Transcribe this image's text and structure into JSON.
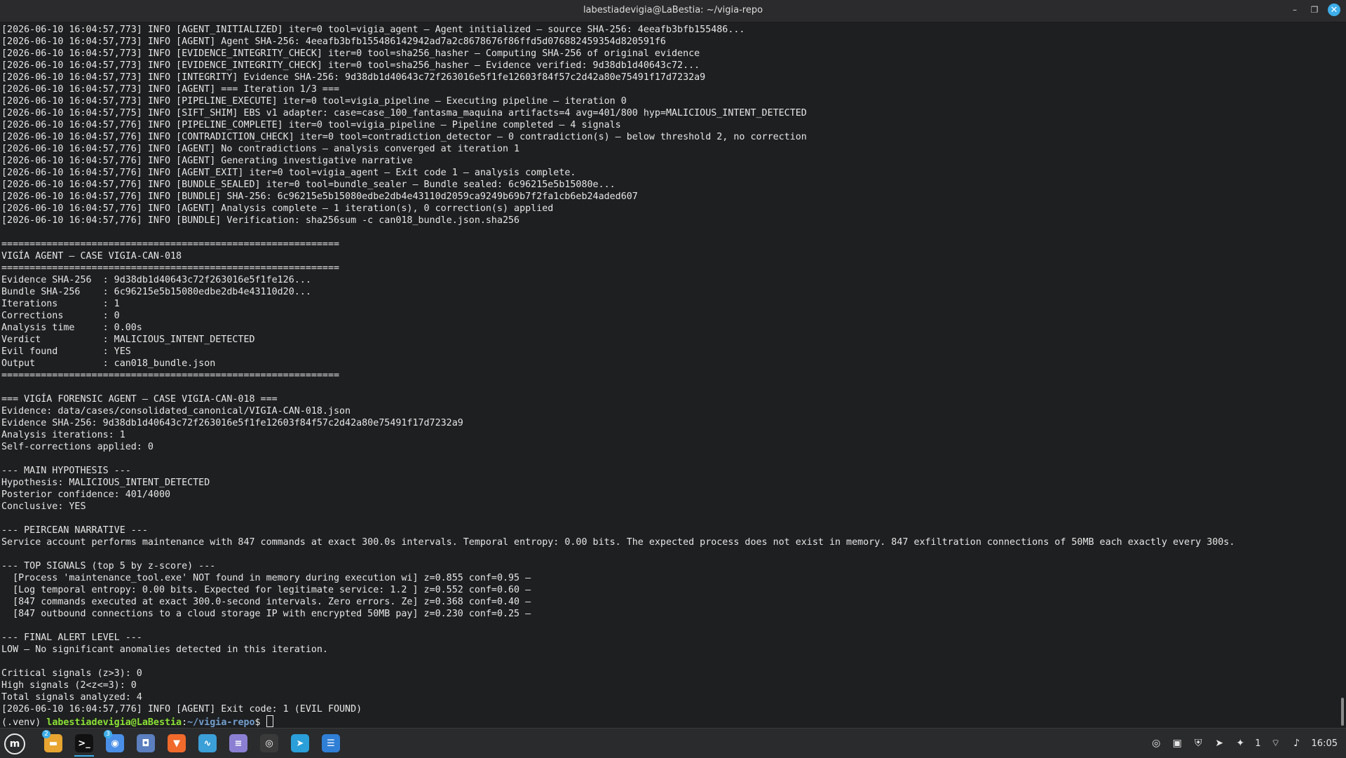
{
  "window": {
    "title": "labestiadevigia@LaBestia: ~/vigia-repo",
    "minimize_icon": "–",
    "restore_icon": "❐",
    "close_icon": "✕"
  },
  "terminal": {
    "lines": [
      "[2026-06-10 16:04:57,773] INFO [AGENT_INITIALIZED] iter=0 tool=vigia_agent — Agent initialized — source SHA-256: 4eeafb3bfb155486...",
      "[2026-06-10 16:04:57,773] INFO [AGENT] Agent SHA-256: 4eeafb3bfb155486142942ad7a2c8678676f86ffd5d076882459354d820591f6",
      "[2026-06-10 16:04:57,773] INFO [EVIDENCE_INTEGRITY_CHECK] iter=0 tool=sha256_hasher — Computing SHA-256 of original evidence",
      "[2026-06-10 16:04:57,773] INFO [EVIDENCE_INTEGRITY_CHECK] iter=0 tool=sha256_hasher — Evidence verified: 9d38db1d40643c72...",
      "[2026-06-10 16:04:57,773] INFO [INTEGRITY] Evidence SHA-256: 9d38db1d40643c72f263016e5f1fe12603f84f57c2d42a80e75491f17d7232a9",
      "[2026-06-10 16:04:57,773] INFO [AGENT] === Iteration 1/3 ===",
      "[2026-06-10 16:04:57,773] INFO [PIPELINE_EXECUTE] iter=0 tool=vigia_pipeline — Executing pipeline — iteration 0",
      "[2026-06-10 16:04:57,775] INFO [SIFT_SHIM] EBS v1 adapter: case=case_100_fantasma_maquina artifacts=4 avg=401/800 hyp=MALICIOUS_INTENT_DETECTED",
      "[2026-06-10 16:04:57,776] INFO [PIPELINE_COMPLETE] iter=0 tool=vigia_pipeline — Pipeline completed — 4 signals",
      "[2026-06-10 16:04:57,776] INFO [CONTRADICTION_CHECK] iter=0 tool=contradiction_detector — 0 contradiction(s) — below threshold 2, no correction",
      "[2026-06-10 16:04:57,776] INFO [AGENT] No contradictions — analysis converged at iteration 1",
      "[2026-06-10 16:04:57,776] INFO [AGENT] Generating investigative narrative",
      "[2026-06-10 16:04:57,776] INFO [AGENT_EXIT] iter=0 tool=vigia_agent — Exit code 1 — analysis complete.",
      "[2026-06-10 16:04:57,776] INFO [BUNDLE_SEALED] iter=0 tool=bundle_sealer — Bundle sealed: 6c96215e5b15080e...",
      "[2026-06-10 16:04:57,776] INFO [BUNDLE] SHA-256: 6c96215e5b15080edbe2db4e43110d2059ca9249b69b7f2fa1cb6eb24aded607",
      "[2026-06-10 16:04:57,776] INFO [AGENT] Analysis complete — 1 iteration(s), 0 correction(s) applied",
      "[2026-06-10 16:04:57,776] INFO [BUNDLE] Verification: sha256sum -c can018_bundle.json.sha256",
      "",
      "============================================================",
      "VIGÍA AGENT — CASE VIGIA-CAN-018",
      "============================================================",
      "Evidence SHA-256  : 9d38db1d40643c72f263016e5f1fe126...",
      "Bundle SHA-256    : 6c96215e5b15080edbe2db4e43110d20...",
      "Iterations        : 1",
      "Corrections       : 0",
      "Analysis time     : 0.00s",
      "Verdict           : MALICIOUS_INTENT_DETECTED",
      "Evil found        : YES",
      "Output            : can018_bundle.json",
      "============================================================",
      "",
      "=== VIGÍA FORENSIC AGENT — CASE VIGIA-CAN-018 ===",
      "Evidence: data/cases/consolidated_canonical/VIGIA-CAN-018.json",
      "Evidence SHA-256: 9d38db1d40643c72f263016e5f1fe12603f84f57c2d42a80e75491f17d7232a9",
      "Analysis iterations: 1",
      "Self-corrections applied: 0",
      "",
      "--- MAIN HYPOTHESIS ---",
      "Hypothesis: MALICIOUS_INTENT_DETECTED",
      "Posterior confidence: 401/4000",
      "Conclusive: YES",
      "",
      "--- PEIRCEAN NARRATIVE ---",
      "Service account performs maintenance with 847 commands at exact 300.0s intervals. Temporal entropy: 0.00 bits. The expected process does not exist in memory. 847 exfiltration connections of 50MB each exactly every 300s.",
      "",
      "--- TOP SIGNALS (top 5 by z-score) ---",
      "  [Process 'maintenance_tool.exe' NOT found in memory during execution wi] z=0.855 conf=0.95 —",
      "  [Log temporal entropy: 0.00 bits. Expected for legitimate service: 1.2 ] z=0.552 conf=0.60 —",
      "  [847 commands executed at exact 300.0-second intervals. Zero errors. Ze] z=0.368 conf=0.40 —",
      "  [847 outbound connections to a cloud storage IP with encrypted 50MB pay] z=0.230 conf=0.25 —",
      "",
      "--- FINAL ALERT LEVEL ---",
      "LOW — No significant anomalies detected in this iteration.",
      "",
      "Critical signals (z>3): 0",
      "High signals (2<z<=3): 0",
      "Total signals analyzed: 4",
      "[2026-06-10 16:04:57,776] INFO [AGENT] Exit code: 1 (EVIL FOUND)"
    ],
    "prompt": {
      "venv": "(.venv) ",
      "user_host": "labestiadevigia@LaBestia",
      "sep": ":",
      "path": "~/vigia-repo",
      "symbol": "$ "
    }
  },
  "taskbar": {
    "menu_glyph": "m",
    "apps": [
      {
        "name": "files",
        "glyph": "▬",
        "color": "#e8a531",
        "badge": "2"
      },
      {
        "name": "terminal",
        "glyph": ">_",
        "color": "#111111",
        "badge": ""
      },
      {
        "name": "chrome",
        "glyph": "◉",
        "color": "#4a8fe7",
        "badge": "3"
      },
      {
        "name": "screenshot",
        "glyph": "◘",
        "color": "#5b7fbf",
        "badge": ""
      },
      {
        "name": "brave",
        "glyph": "▼",
        "color": "#f06a2b",
        "badge": ""
      },
      {
        "name": "system-monitor",
        "glyph": "∿",
        "color": "#3b9fd8",
        "badge": ""
      },
      {
        "name": "text-editor",
        "glyph": "≡",
        "color": "#8b7fd4",
        "badge": ""
      },
      {
        "name": "obs",
        "glyph": "◎",
        "color": "#3a3a3a",
        "badge": ""
      },
      {
        "name": "telegram",
        "glyph": "➤",
        "color": "#2a9fd9",
        "badge": ""
      },
      {
        "name": "notes",
        "glyph": "☰",
        "color": "#2f7fd6",
        "badge": ""
      }
    ],
    "tray": {
      "obs_icon": "◎",
      "clipboard_icon": "▣",
      "shield_icon": "⛨",
      "telegram_icon": "➤",
      "notify_icon": "✦",
      "notify_count": "1",
      "wifi_icon": "⌔",
      "volume_icon": "♪",
      "clock": "16:05"
    }
  }
}
